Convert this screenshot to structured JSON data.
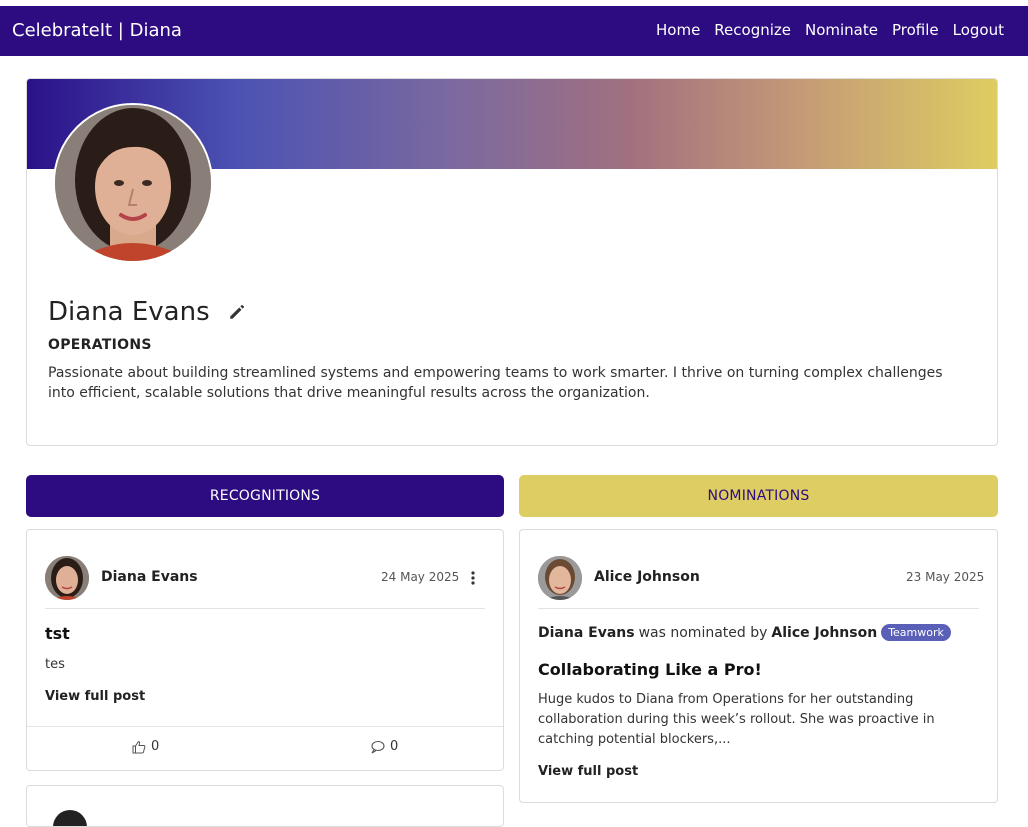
{
  "navbar": {
    "brand": "CelebrateIt | Diana",
    "links": [
      "Home",
      "Recognize",
      "Nominate",
      "Profile",
      "Logout"
    ]
  },
  "profile": {
    "name": "Diana Evans",
    "department": "OPERATIONS",
    "bio": "Passionate about building streamlined systems and empowering teams to work smarter. I thrive on turning complex challenges into efficient, scalable solutions that drive meaningful results across the organization."
  },
  "tabs": {
    "recognitions": "RECOGNITIONS",
    "nominations": "NOMINATIONS"
  },
  "recognition_post": {
    "author": "Diana Evans",
    "date": "24 May 2025",
    "title": "tst",
    "body": "tes",
    "view_label": "View full post",
    "likes": "0",
    "comments": "0"
  },
  "nomination_post": {
    "author": "Alice Johnson",
    "date": "23 May 2025",
    "nominee": "Diana Evans",
    "connector": "was nominated by",
    "nominator": "Alice Johnson",
    "category": "Teamwork",
    "title": "Collaborating Like a Pro!",
    "body": "Huge kudos to Diana from Operations for her outstanding collaboration during this week’s rollout. She was proactive in catching potential blockers,...",
    "view_label": "View full post"
  },
  "colors": {
    "primary": "#2d0b80",
    "accent": "#ddcd63",
    "badge": "#5a5fb8"
  }
}
